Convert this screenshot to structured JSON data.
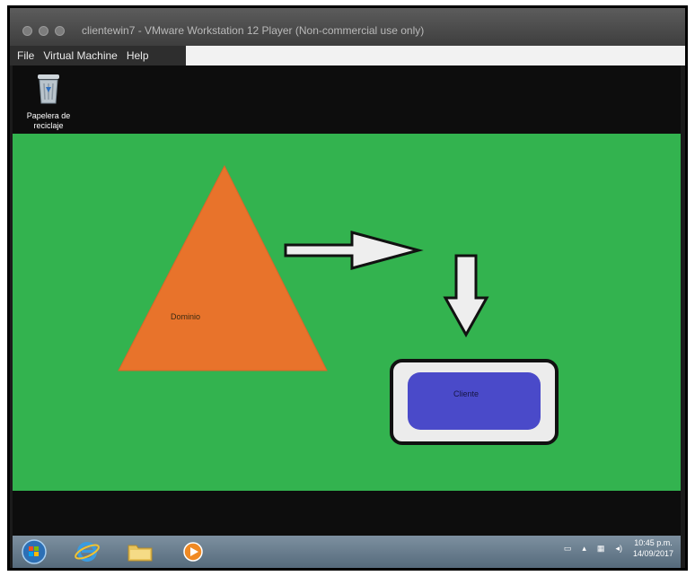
{
  "window": {
    "title": "clientewin7 - VMware Workstation 12 Player (Non-commercial use only)"
  },
  "menu": [
    "File",
    "Virtual Machine",
    "Help"
  ],
  "desktop": {
    "recycle_bin_label": "Papelera de reciclaje",
    "diagram": {
      "domain_label": "Dominio",
      "client_label": "Cliente",
      "colors": {
        "triangle": "#e8732b",
        "client": "#4a4ac9",
        "background": "#33b34f"
      }
    }
  },
  "taskbar": {
    "time": "10:45 p.m.",
    "date": "14/09/2017"
  }
}
